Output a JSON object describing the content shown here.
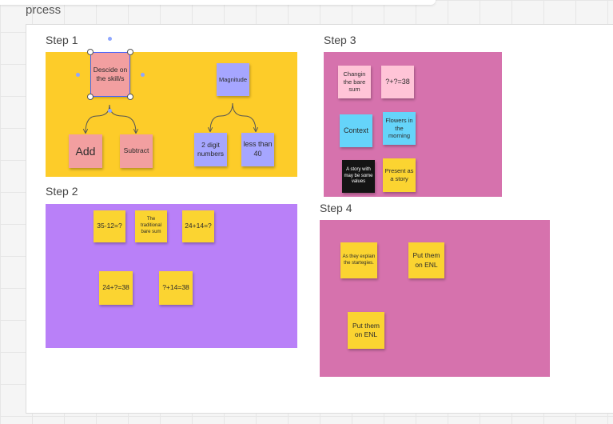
{
  "board": {
    "title": "prcess"
  },
  "steps": {
    "step1": {
      "label": "Step 1",
      "notes": {
        "decide": "Descide on the skill/s",
        "magnitude": "Magnitude",
        "add": "Add",
        "subtract": "Subtract",
        "two_digit": "2 digit numbers",
        "less_than": "less than 40"
      }
    },
    "step2": {
      "label": "Step 2",
      "notes": {
        "n1": "35-12=?",
        "n2": "The traditional bare sum",
        "n3": "24+14=?",
        "n4": "24+?=38",
        "n5": "?+14=38"
      }
    },
    "step3": {
      "label": "Step 3",
      "notes": {
        "changin": "Changin the bare sum",
        "eq": "?+?=38",
        "context": "Context",
        "flowers": "Flowers in the morning",
        "story_values": "A story with may be some values",
        "present": "Present as a story"
      }
    },
    "step4": {
      "label": "Step 4",
      "notes": {
        "explain": "As they explain the startegies.",
        "enl1": "Put them on ENL",
        "enl2": "Put them on ENL"
      }
    }
  },
  "colors": {
    "step1_bg": "#fdcc29",
    "step2_bg": "#b980f8",
    "step3_bg": "#d672ad",
    "step4_bg": "#d672ad",
    "selection": "#4262ff"
  }
}
